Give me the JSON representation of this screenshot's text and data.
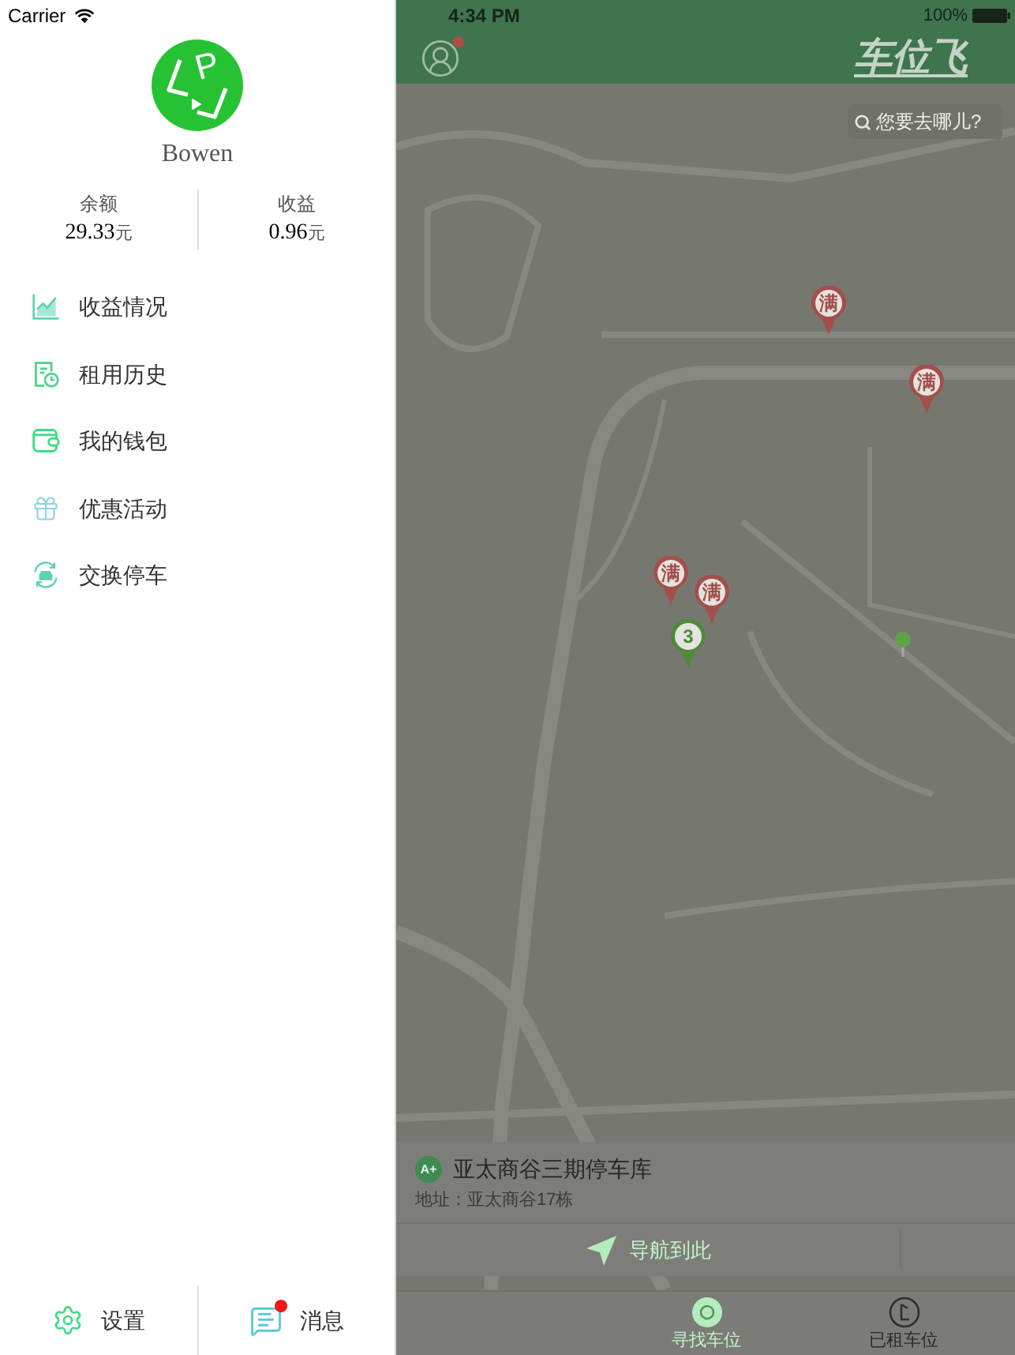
{
  "status_bar": {
    "carrier": "Carrier",
    "time": "4:34 PM",
    "battery": "100%"
  },
  "drawer": {
    "avatar": {
      "letter": "P"
    },
    "name": "Bowen",
    "stats": [
      {
        "label": "余额",
        "value": "29.33",
        "unit": "元"
      },
      {
        "label": "收益",
        "value": "0.96",
        "unit": "元"
      }
    ],
    "menu": [
      {
        "kind": "chart",
        "label": "收益情况"
      },
      {
        "kind": "history",
        "label": "租用历史"
      },
      {
        "kind": "wallet",
        "label": "我的钱包"
      },
      {
        "kind": "gift",
        "label": "优惠活动"
      },
      {
        "kind": "swap",
        "label": "交换停车"
      }
    ],
    "footer": [
      {
        "kind": "settings",
        "label": "设置",
        "badge": false
      },
      {
        "kind": "messages",
        "label": "消息",
        "badge": true
      }
    ]
  },
  "map_screen": {
    "header": {
      "logo": "车位飞",
      "profile_badge": true
    },
    "search": {
      "placeholder": "您要去哪儿?"
    },
    "pins": [
      {
        "kind": "bubble",
        "label": "满",
        "color": "#a34f4c"
      },
      {
        "kind": "bubble",
        "label": "满",
        "color": "#a34f4c"
      },
      {
        "kind": "bubble",
        "label": "满",
        "color": "#a34f4c"
      },
      {
        "kind": "bubble",
        "label": "满",
        "color": "#a34f4c"
      },
      {
        "kind": "bubble",
        "label": "3",
        "color": "#4f8a3c"
      },
      {
        "kind": "stick",
        "color": "#5ea34a"
      }
    ],
    "place": {
      "badge": "A+",
      "name": "亚太商谷三期停车库",
      "address": "地址：亚太商谷17栋",
      "action": "导航到此"
    },
    "tabs": [
      {
        "kind": "find",
        "label": "寻找车位",
        "selected": true
      },
      {
        "kind": "rented",
        "label": "已租车位",
        "selected": false
      }
    ]
  }
}
